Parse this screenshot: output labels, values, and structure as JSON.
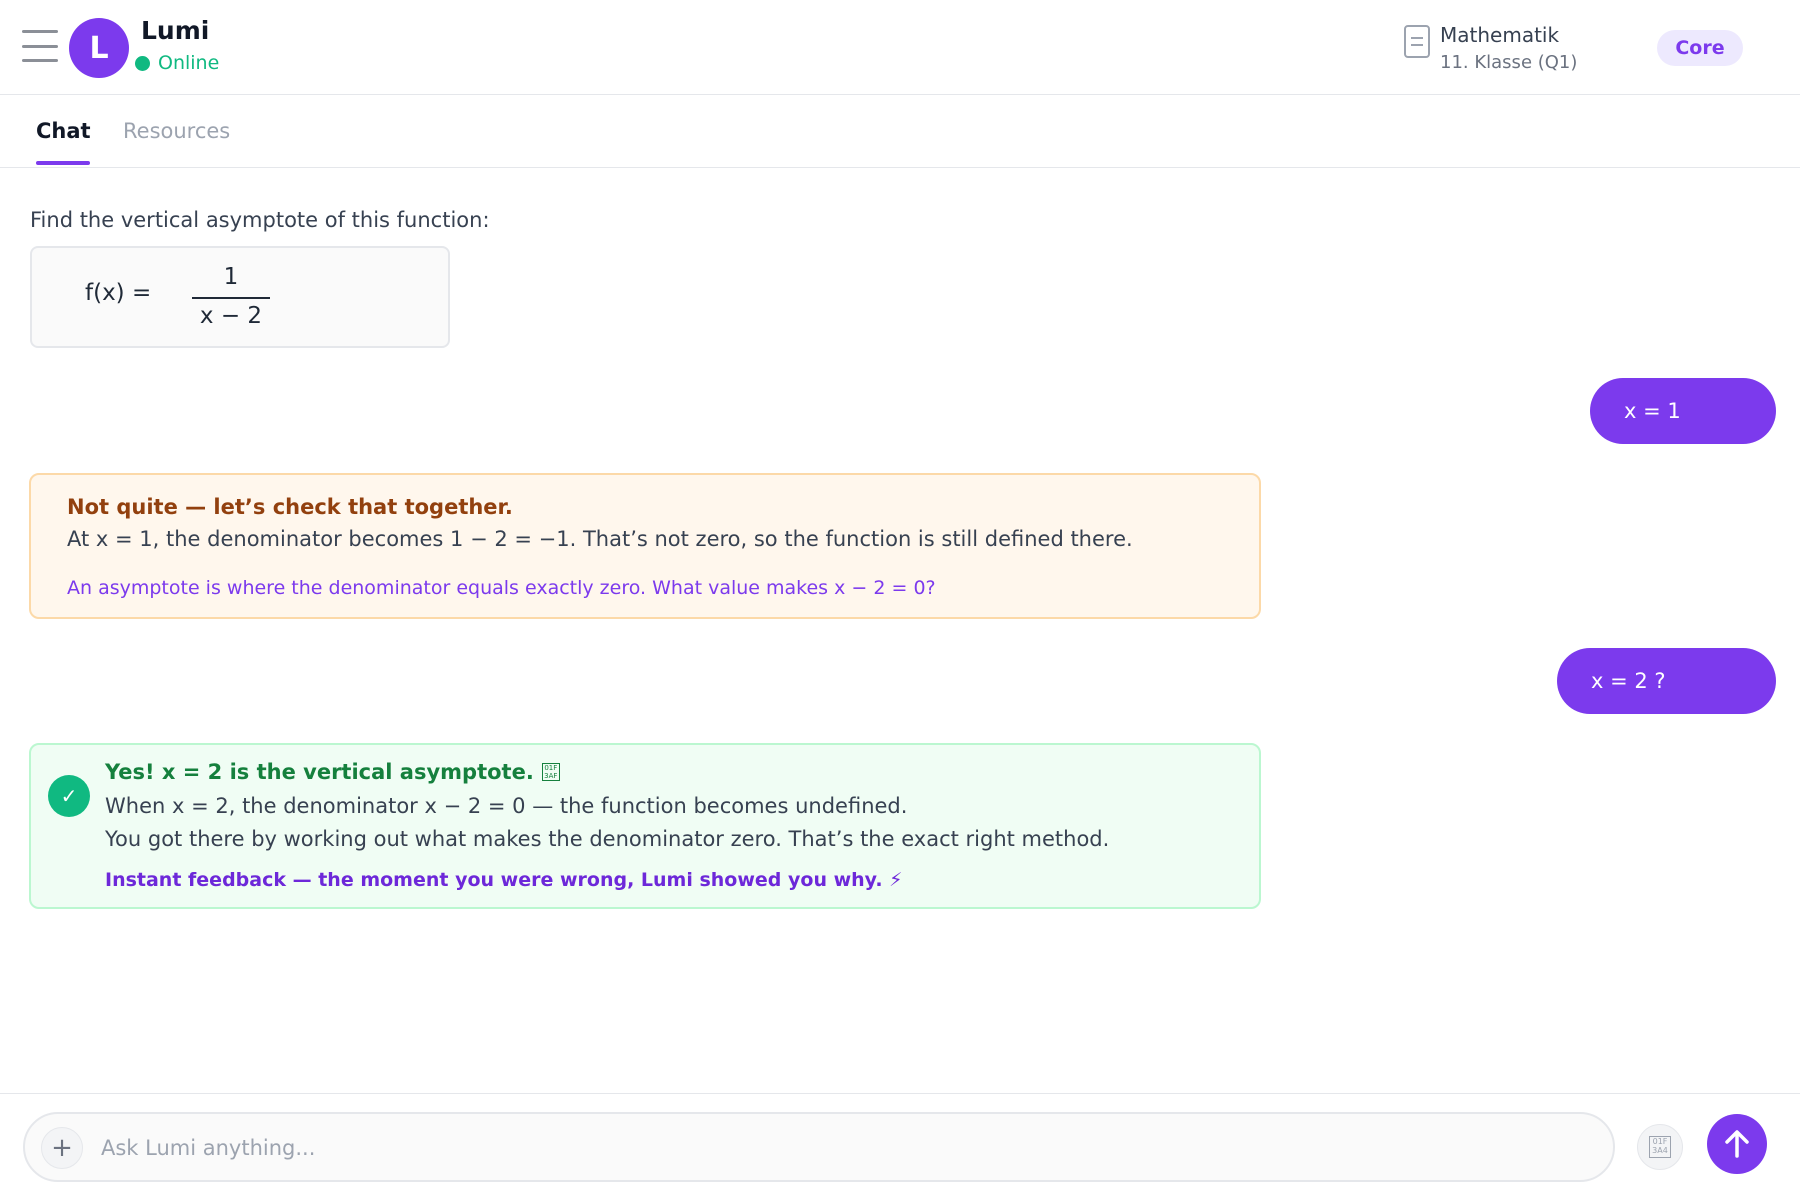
{
  "header": {
    "avatar_letter": "L",
    "bot_name": "Lumi",
    "status": "Online",
    "subject": "Mathematik",
    "grade": "11. Klasse (Q1)",
    "tier": "Core"
  },
  "tabs": [
    {
      "label": "Chat",
      "active": true
    },
    {
      "label": "Resources",
      "active": false
    }
  ],
  "chat": {
    "prompt": "Find the vertical asymptote of this function:",
    "formula": {
      "lhs": "f(x) =",
      "numerator": "1",
      "denominator": "x − 2"
    },
    "user_answer_1": "x = 1",
    "feedback_wrong": {
      "title": "Not quite — let’s check that together.",
      "body": "At x = 1, the denominator becomes 1 − 2 = −1. That’s not zero, so the function is still defined there.",
      "hint": "An asymptote is where the denominator equals exactly zero. What value makes x − 2 = 0?"
    },
    "user_answer_2": "x = 2 ?",
    "feedback_right": {
      "title": "Yes! x = 2 is the vertical asymptote.",
      "line1": "When x = 2, the denominator x − 2 = 0 — the function becomes undefined.",
      "line2": "You got there by working out what makes the denominator zero. That’s the exact right method.",
      "note": "Instant feedback — the moment you were wrong, Lumi showed you why. ⚡"
    }
  },
  "composer": {
    "placeholder": "Ask Lumi anything...",
    "value": ""
  },
  "colors": {
    "accent": "#7c3aed",
    "online": "#10b981",
    "warning_bg": "#fff7ed",
    "success_bg": "#f0fdf4"
  },
  "icons": {
    "menu": "hamburger-menu-icon",
    "subject": "document-icon",
    "check": "checkmark-icon",
    "attach": "plus-icon",
    "mic": "microphone-icon",
    "send": "arrow-up-icon"
  }
}
